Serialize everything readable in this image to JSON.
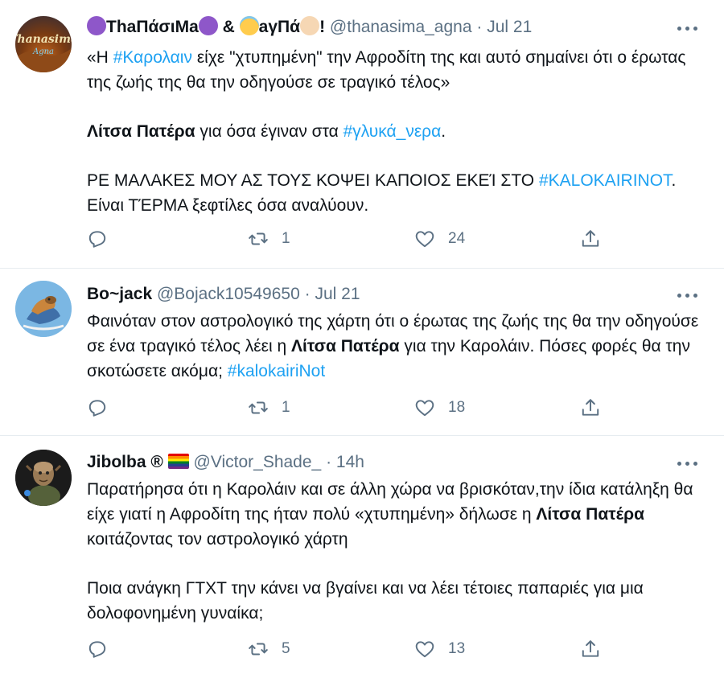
{
  "tweets": [
    {
      "name_parts": [
        "😈",
        "ThaΠάσιΜa",
        "😈",
        " & ",
        "😇",
        "aγΠά",
        "👼",
        "!"
      ],
      "name_text_1": "ThaΠάσιΜa",
      "name_amp": " & ",
      "name_text_2": "aγΠά",
      "name_bang": "!",
      "avatar_text": "Thanasima Agna",
      "handle": "@thanasima_agna",
      "dot": "·",
      "time": "Jul 21",
      "body": {
        "l1_a": "«Η ",
        "l1_tag": "#Καρολαιν",
        "l1_b": " είχε \"χτυπημένη\" την Αφροδίτη της και αυτό σημαίνει ότι ο έρωτας της ζωής της θα την οδηγούσε σε τραγικό τέλος»",
        "l2_bold": "Λίτσα Πατέρα",
        "l2_a": " για όσα έγιναν στα ",
        "l2_tag": "#γλυκά_νερα",
        "l2_b": ".",
        "l3_a": "ΡΕ ΜΑΛΑΚΕΣ ΜΟΥ ΑΣ ΤΟΥΣ ΚΟΨΕΙ ΚΑΠΟΙΟΣ ΕΚΕΊ ΣΤΟ ",
        "l3_tag": "#KALOKAIRINOT",
        "l3_b": ". Είναι ΤΈΡΜΑ ξεφτίλες όσα αναλύουν."
      },
      "retweets": "1",
      "likes": "24"
    },
    {
      "name": "Bo~jack",
      "handle": "@Bojack10549650",
      "dot": "·",
      "time": "Jul 21",
      "body": {
        "a": "Φαινόταν στον αστρολογικό της χάρτη ότι ο έρωτας της ζωής της θα την οδηγούσε σε ένα τραγικό τέλος λέει η ",
        "bold": "Λίτσα Πατέρα",
        "b": " για την Καρολάιν. Πόσες φορές θα την σκοτώσετε ακόμα; ",
        "tag": "#kalokairiNot"
      },
      "retweets": "1",
      "likes": "18"
    },
    {
      "name": "Jibolba ®",
      "handle": "@Victor_Shade_",
      "dot": "·",
      "time": "14h",
      "body": {
        "a": "Παρατήρησα ότι η Καρολάιν και σε άλλη χώρα να βρισκόταν,την ίδια κατάληξη θα είχε γιατί η Αφροδίτη της ήταν πολύ «χτυπημένη» δήλωσε η ",
        "bold": "Λίτσα Πατέρα",
        "b": " κοιτάζοντας τον αστρολογικό χάρτη",
        "p2": "Ποια ανάγκη ΓΤΧΤ την κάνει να βγαίνει και να λέει τέτοιες παπαριές για μια δολοφονημένη γυναίκα;"
      },
      "retweets": "5",
      "likes": "13"
    }
  ],
  "icons": {
    "reply": "reply-icon",
    "retweet": "retweet-icon",
    "like": "heart-icon",
    "share": "share-icon",
    "more": "more-icon"
  },
  "colors": {
    "link": "#1da1f2",
    "secondary": "#5b7083",
    "text": "#0f1419",
    "divider": "#e6ecf0"
  }
}
